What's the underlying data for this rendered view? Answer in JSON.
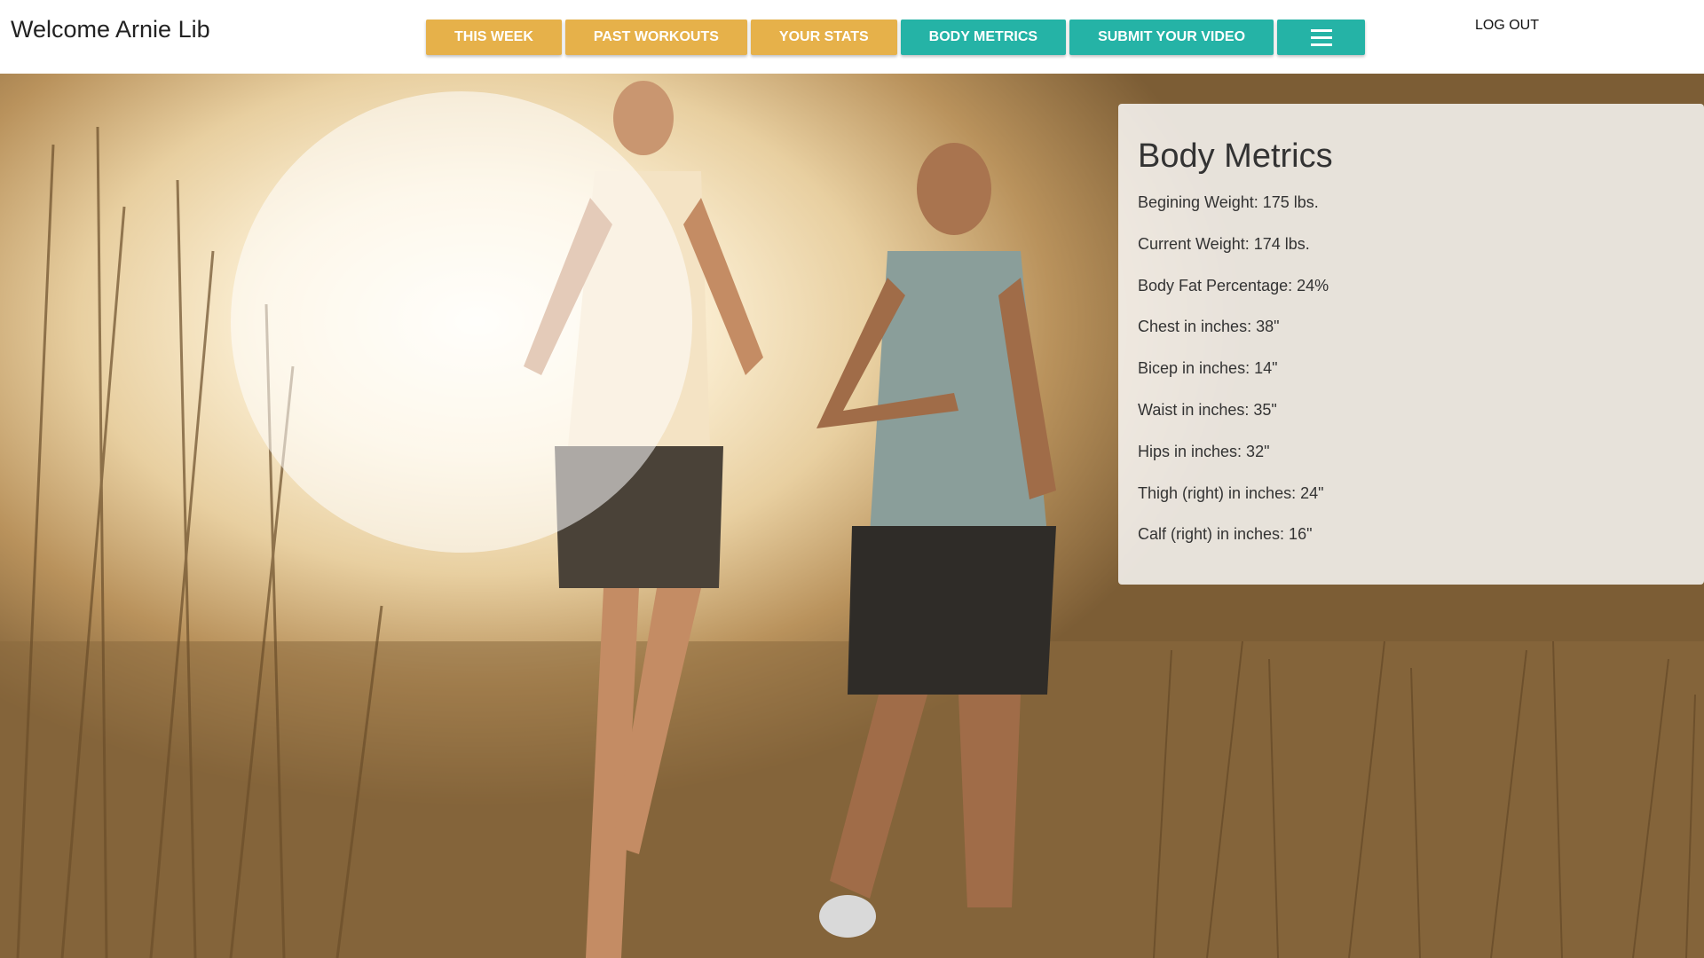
{
  "header": {
    "welcome": "Welcome Arnie Lib",
    "logout": "LOG OUT",
    "nav": [
      {
        "label": "THIS WEEK",
        "color": "#e6b14a"
      },
      {
        "label": "PAST WORKOUTS",
        "color": "#e6b14a"
      },
      {
        "label": "YOUR STATS",
        "color": "#e6b14a"
      },
      {
        "label": "BODY METRICS",
        "color": "#25b3a6"
      },
      {
        "label": "SUBMIT YOUR VIDEO",
        "color": "#25b3a6"
      }
    ],
    "menu_icon": "hamburger-icon"
  },
  "hero": {
    "image": "two-runners-on-grassy-trail"
  },
  "metrics": {
    "title": "Body Metrics",
    "rows": [
      "Begining Weight: 175 lbs.",
      "Current Weight: 174 lbs.",
      "Body Fat Percentage: 24%",
      "Chest in inches: 38\"",
      "Bicep in inches: 14\"",
      "Waist in inches: 35\"",
      "Hips in inches: 32\"",
      "Thigh (right) in inches: 24\"",
      "Calf (right) in inches: 16\""
    ]
  }
}
